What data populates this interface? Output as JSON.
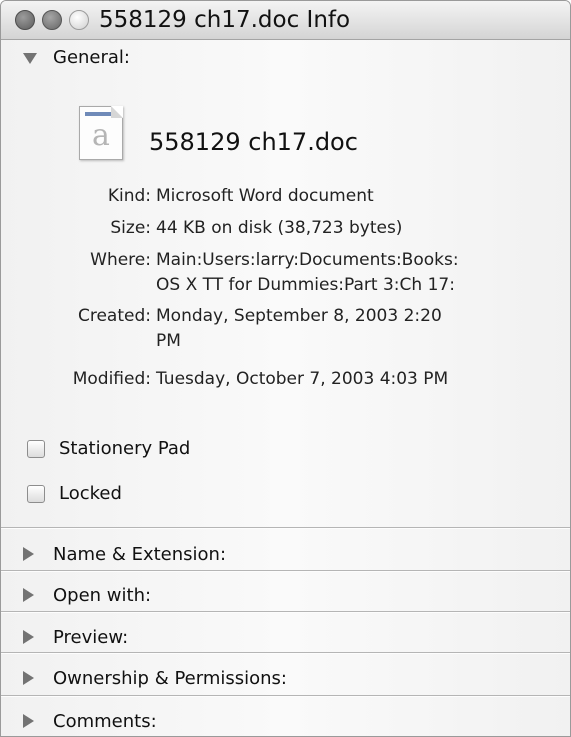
{
  "window": {
    "title": "558129 ch17.doc Info"
  },
  "general": {
    "label": "General:",
    "file_name": "558129 ch17.doc",
    "icon_glyph": "a",
    "fields": [
      {
        "label": "Kind:",
        "lines": [
          "Microsoft Word document"
        ]
      },
      {
        "label": "Size:",
        "lines": [
          "44 KB on disk (38,723 bytes)"
        ]
      },
      {
        "label": "Where:",
        "lines": [
          "Main:Users:larry:Documents:Books:",
          "OS X TT for Dummies:Part 3:Ch 17:"
        ]
      },
      {
        "label": "Created:",
        "lines": [
          "Monday, September 8, 2003 2:20",
          "PM"
        ]
      },
      {
        "label": "Modified:",
        "lines": [
          "Tuesday, October 7, 2003 4:03 PM"
        ]
      }
    ],
    "checkboxes": [
      {
        "label": "Stationery Pad",
        "checked": false
      },
      {
        "label": "Locked",
        "checked": false
      }
    ]
  },
  "sections": [
    {
      "label": "Name & Extension:"
    },
    {
      "label": "Open with:"
    },
    {
      "label": "Preview:"
    },
    {
      "label": "Ownership & Permissions:"
    },
    {
      "label": "Comments:"
    }
  ]
}
